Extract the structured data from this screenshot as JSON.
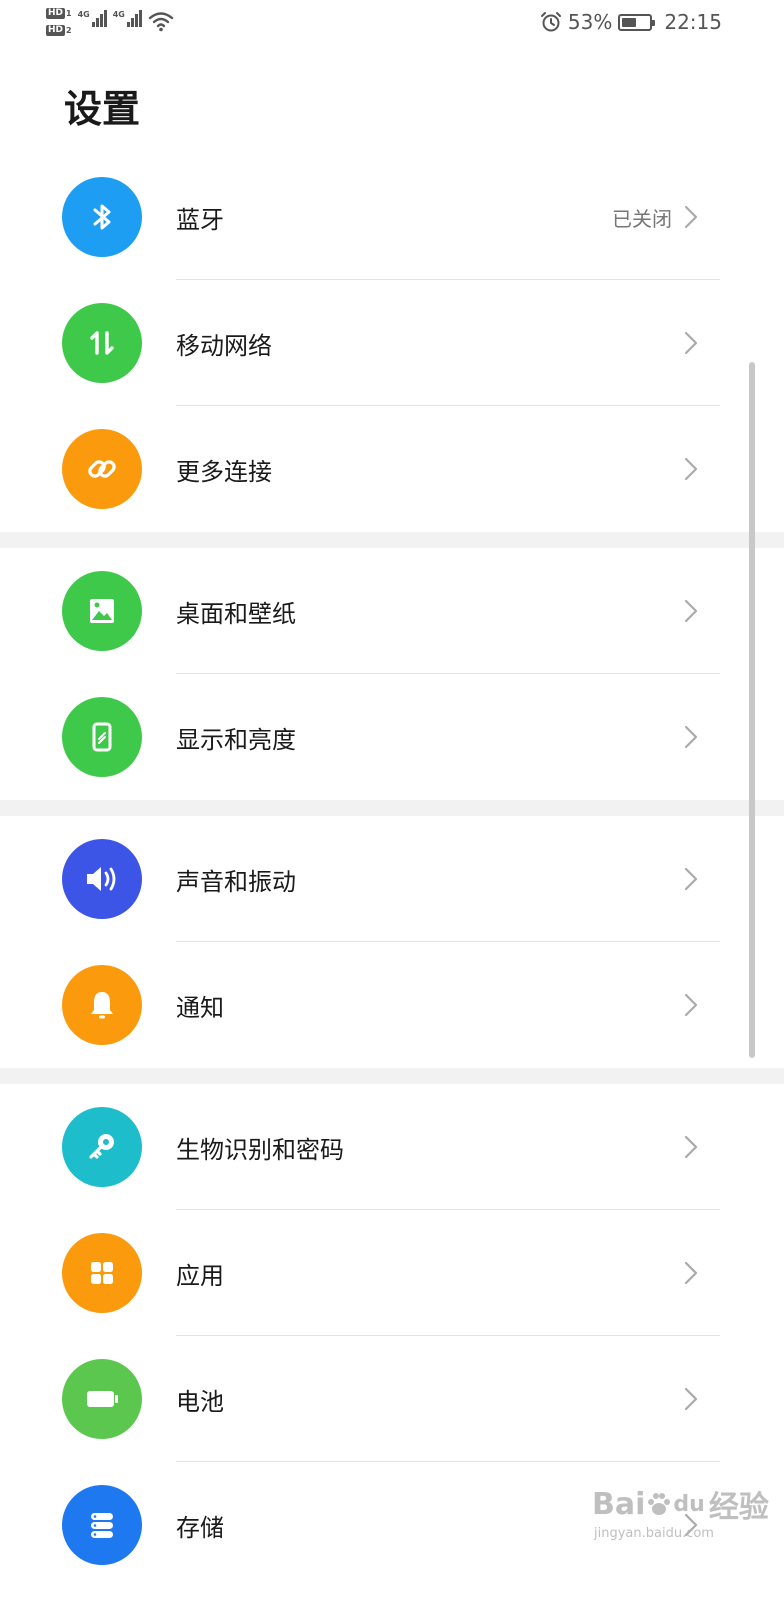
{
  "status_bar": {
    "sim1": {
      "badge": "HD",
      "slot": "1",
      "network": "4G"
    },
    "sim2": {
      "badge": "HD",
      "slot": "2",
      "network": "4G"
    },
    "alarm_icon": "alarm-clock-icon",
    "wifi_icon": "wifi-icon",
    "battery_percent": "53%",
    "battery_level": 0.53,
    "time": "22:15"
  },
  "header": {
    "title": "设置"
  },
  "groups": [
    {
      "items": [
        {
          "id": "bluetooth",
          "label": "蓝牙",
          "value": "已关闭",
          "icon": "bluetooth-icon",
          "color": "#1e9ef2"
        },
        {
          "id": "mobile-network",
          "label": "移动网络",
          "value": "",
          "icon": "data-transfer-icon",
          "color": "#3fc94b"
        },
        {
          "id": "more-connections",
          "label": "更多连接",
          "value": "",
          "icon": "link-icon",
          "color": "#fb9a0d"
        }
      ]
    },
    {
      "items": [
        {
          "id": "home-wallpaper",
          "label": "桌面和壁纸",
          "value": "",
          "icon": "image-icon",
          "color": "#3fc94b"
        },
        {
          "id": "display-brightness",
          "label": "显示和亮度",
          "value": "",
          "icon": "phone-display-icon",
          "color": "#3fc94b"
        }
      ]
    },
    {
      "items": [
        {
          "id": "sound-vibration",
          "label": "声音和振动",
          "value": "",
          "icon": "speaker-icon",
          "color": "#3d55e6"
        },
        {
          "id": "notifications",
          "label": "通知",
          "value": "",
          "icon": "bell-icon",
          "color": "#fb9a0d"
        }
      ]
    },
    {
      "items": [
        {
          "id": "biometrics-password",
          "label": "生物识别和密码",
          "value": "",
          "icon": "key-icon",
          "color": "#1dbdcc"
        },
        {
          "id": "apps",
          "label": "应用",
          "value": "",
          "icon": "apps-grid-icon",
          "color": "#fb9a0d"
        },
        {
          "id": "battery",
          "label": "电池",
          "value": "",
          "icon": "battery-icon",
          "color": "#5cc74f"
        },
        {
          "id": "storage",
          "label": "存储",
          "value": "",
          "icon": "storage-icon",
          "color": "#1e78f0"
        }
      ]
    }
  ],
  "watermark": {
    "brand": "Bai",
    "brand_tail": "du",
    "suffix": "经验",
    "url": "jingyan.baidu.com"
  }
}
